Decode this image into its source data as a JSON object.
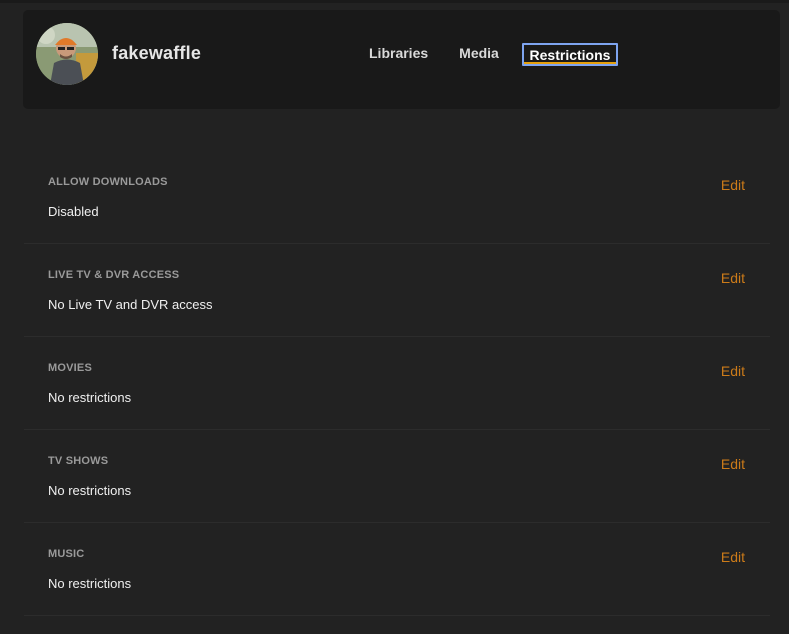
{
  "user": {
    "username": "fakewaffle"
  },
  "nav": {
    "tabs": [
      {
        "label": "Libraries"
      },
      {
        "label": "Media"
      },
      {
        "label": "Restrictions",
        "active": true
      }
    ]
  },
  "restrictions": [
    {
      "label": "ALLOW DOWNLOADS",
      "value": "Disabled",
      "edit_label": "Edit"
    },
    {
      "label": "LIVE TV & DVR ACCESS",
      "value": "No Live TV and DVR access",
      "edit_label": "Edit"
    },
    {
      "label": "MOVIES",
      "value": "No restrictions",
      "edit_label": "Edit"
    },
    {
      "label": "TV SHOWS",
      "value": "No restrictions",
      "edit_label": "Edit"
    },
    {
      "label": "MUSIC",
      "value": "No restrictions",
      "edit_label": "Edit"
    }
  ],
  "colors": {
    "background": "#222222",
    "header_bg": "#191919",
    "accent": "#e5a00d",
    "edit_link": "#cc7b19",
    "focus_ring": "#7ea4f0"
  }
}
